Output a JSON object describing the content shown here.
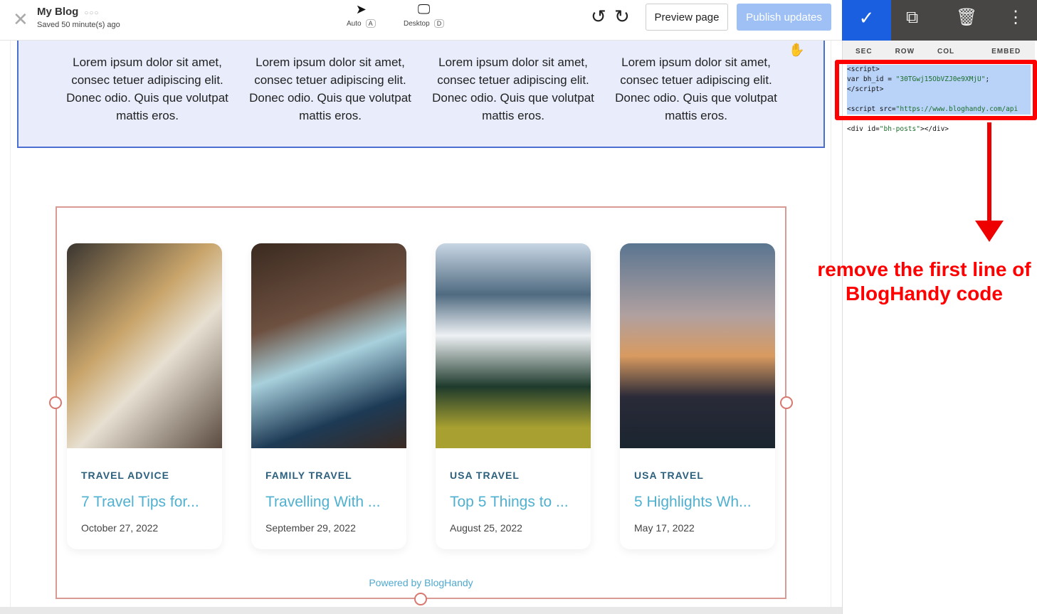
{
  "header": {
    "title": "My Blog",
    "more": "○○○",
    "saved": "Saved 50 minute(s) ago",
    "modes": [
      {
        "label": "Auto",
        "key": "A",
        "icon": "cursor-icon"
      },
      {
        "label": "Desktop",
        "key": "D",
        "icon": "desktop-icon"
      }
    ],
    "preview": "Preview page",
    "publish": "Publish updates"
  },
  "features": [
    "Lorem ipsum dolor sit amet, consec tetuer adipiscing elit. Donec odio. Quis que volutpat mattis eros.",
    "Lorem ipsum dolor sit amet, consec tetuer adipiscing elit. Donec odio. Quis que volutpat mattis eros.",
    "Lorem ipsum dolor sit amet, consec tetuer adipiscing elit. Donec odio. Quis que volutpat mattis eros.",
    "Lorem ipsum dolor sit amet, consec tetuer adipiscing elit. Donec odio. Quis que volutpat mattis eros."
  ],
  "posts": [
    {
      "category": "TRAVEL ADVICE",
      "title": "7 Travel Tips for...",
      "date": "October 27, 2022"
    },
    {
      "category": "FAMILY TRAVEL",
      "title": "Travelling With ...",
      "date": "September 29, 2022"
    },
    {
      "category": "USA TRAVEL",
      "title": "Top 5 Things to ...",
      "date": "August 25, 2022"
    },
    {
      "category": "USA TRAVEL",
      "title": "5 Highlights Wh...",
      "date": "May 17, 2022"
    }
  ],
  "powered": "Powered by BlogHandy",
  "panel": {
    "crumbs": [
      "SEC",
      "ROW",
      "COL",
      "EMBED"
    ],
    "code": {
      "l1": "<script>",
      "l2a": "var bh_id = ",
      "l2b": "\"30TGwj15ObVZJ0e9XMjU\"",
      "l2c": ";",
      "l3": "</script>",
      "l5a": "<script src=",
      "l5b": "\"https://www.bloghandy.com/api",
      "l6a": "<div id=",
      "l6b": "\"bh-posts\"",
      "l6c": "></div>"
    }
  },
  "annotation": "remove the first line of BlogHandy code",
  "colors": {
    "accent": "#1a5fe0",
    "annotation": "#ff0000",
    "title": "#4fb0d0"
  }
}
